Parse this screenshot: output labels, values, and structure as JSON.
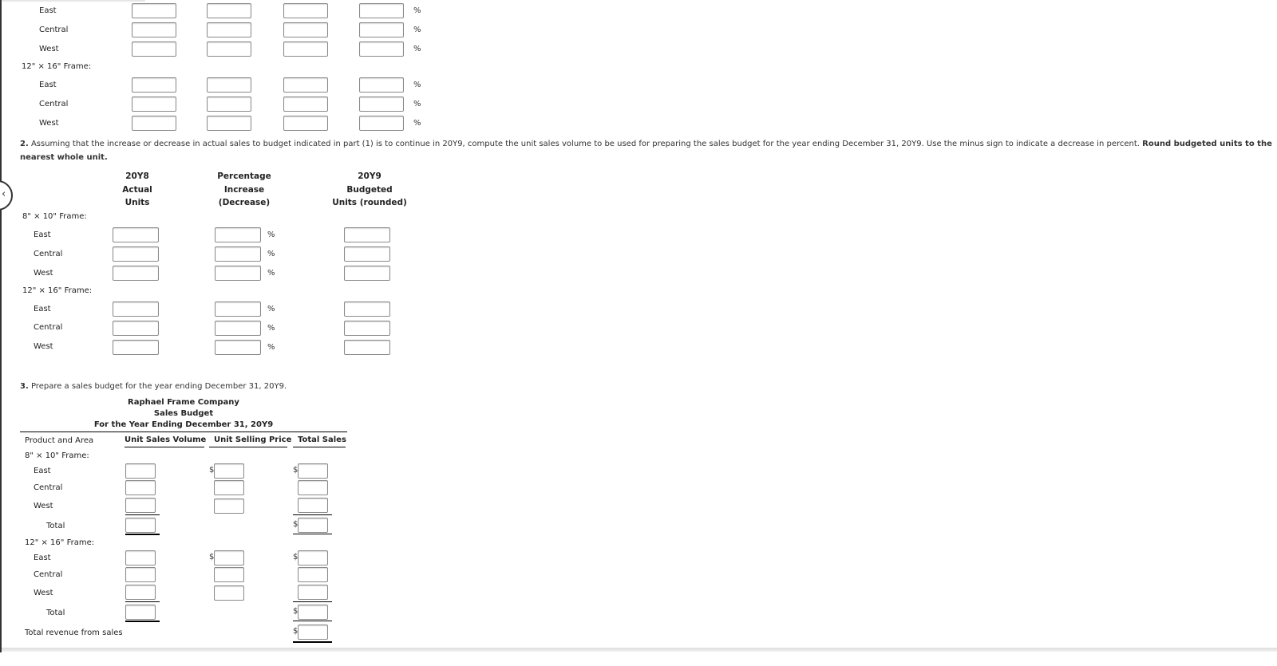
{
  "part1_rows": {
    "regions": [
      "East",
      "Central",
      "West"
    ],
    "frame2_label": "12\" × 16\" Frame:",
    "pct_symbol": "%"
  },
  "part2": {
    "number": "2.",
    "text_a": " Assuming that the increase or decrease in actual sales to budget indicated in part (1) is to continue in 20Y9, compute the unit sales volume to be used for preparing the sales budget for the year ending December 31, 20Y9. Use the minus sign to indicate a decrease in percent. ",
    "text_bold": "Round budgeted units to the nearest whole unit.",
    "headers": {
      "col1": [
        "20Y8",
        "Actual",
        "Units"
      ],
      "col2": [
        "Percentage",
        "Increase",
        "(Decrease)"
      ],
      "col3": [
        "20Y9",
        "Budgeted",
        "Units (rounded)"
      ]
    },
    "frame1_label": "8\" × 10\" Frame:",
    "frame2_label": "12\" × 16\" Frame:",
    "regions": [
      "East",
      "Central",
      "West"
    ],
    "pct_symbol": "%"
  },
  "part3": {
    "number": "3.",
    "text": " Prepare a sales budget for the year ending December 31, 20Y9.",
    "company": "Raphael Frame Company",
    "title": "Sales Budget",
    "period": "For the Year Ending December 31, 20Y9",
    "col_product": "Product and Area",
    "col_volume": "Unit Sales Volume",
    "col_price": "Unit Selling Price",
    "col_total": "Total Sales",
    "frame1_label": "8\" × 10\" Frame:",
    "frame2_label": "12\" × 16\" Frame:",
    "regions": [
      "East",
      "Central",
      "West"
    ],
    "total_label": "Total",
    "revenue_label": "Total revenue from sales",
    "currency": "$"
  },
  "nav": {
    "prev_icon": "‹"
  }
}
